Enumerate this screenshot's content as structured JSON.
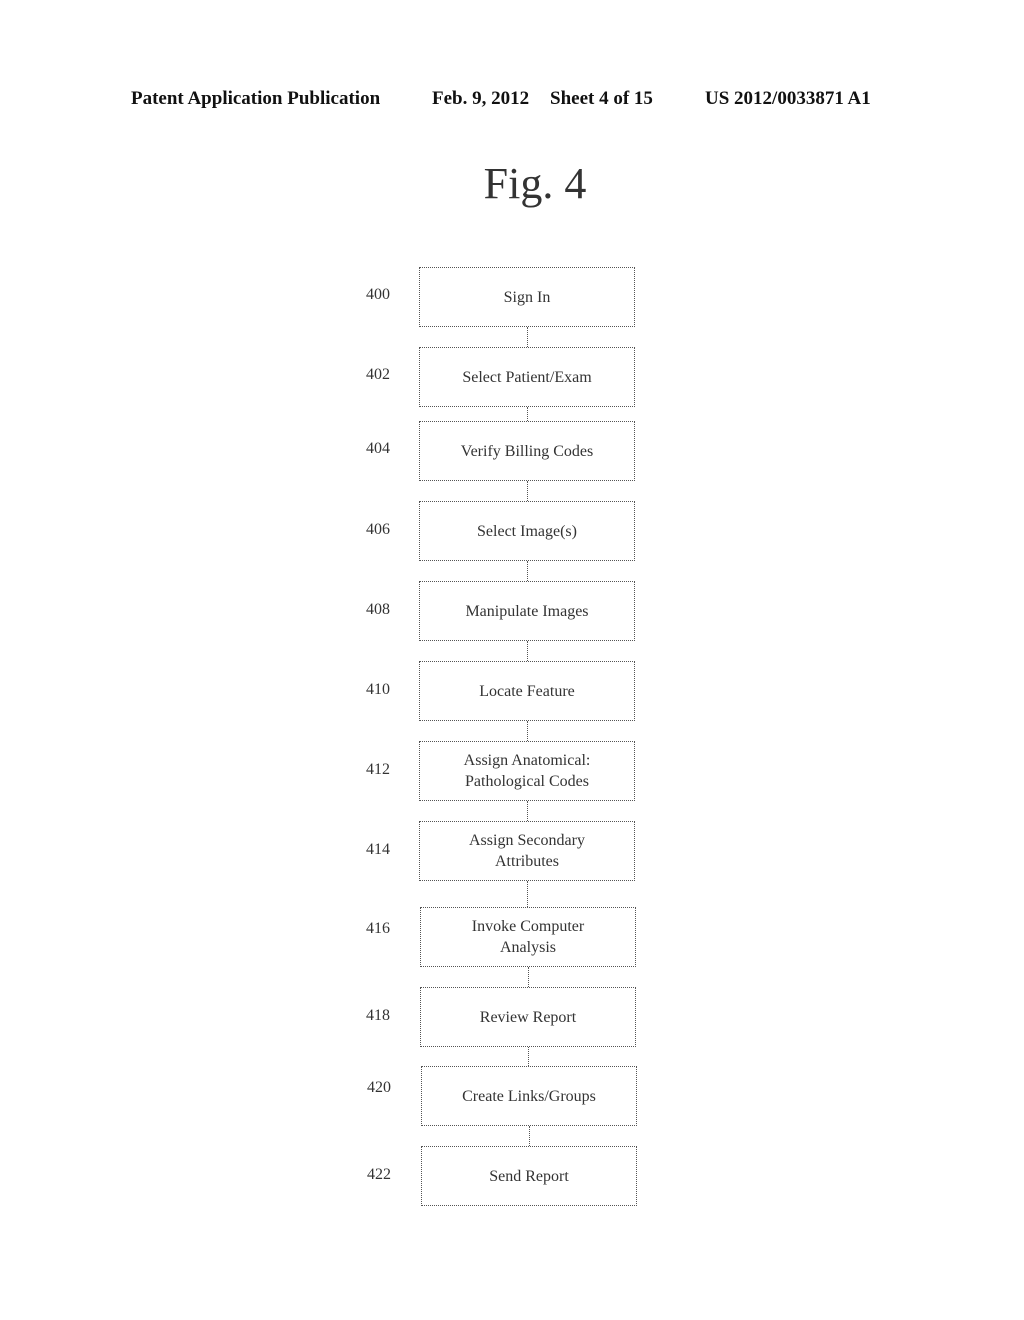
{
  "header": {
    "publication": "Patent Application Publication",
    "date": "Feb. 9, 2012",
    "sheet": "Sheet 4 of 15",
    "number": "US 2012/0033871 A1"
  },
  "figure": {
    "title": "Fig. 4",
    "steps": [
      {
        "num": "400",
        "label": "Sign In"
      },
      {
        "num": "402",
        "label": "Select Patient/Exam"
      },
      {
        "num": "404",
        "label": "Verify Billing Codes"
      },
      {
        "num": "406",
        "label": "Select Image(s)"
      },
      {
        "num": "408",
        "label": "Manipulate Images"
      },
      {
        "num": "410",
        "label": "Locate Feature"
      },
      {
        "num": "412",
        "label": "Assign Anatomical: Pathological Codes"
      },
      {
        "num": "414",
        "label": "Assign Secondary Attributes"
      },
      {
        "num": "416",
        "label": "Invoke Computer Analysis"
      },
      {
        "num": "418",
        "label": "Review Report"
      },
      {
        "num": "420",
        "label": "Create Links/Groups"
      },
      {
        "num": "422",
        "label": "Send Report"
      }
    ]
  }
}
